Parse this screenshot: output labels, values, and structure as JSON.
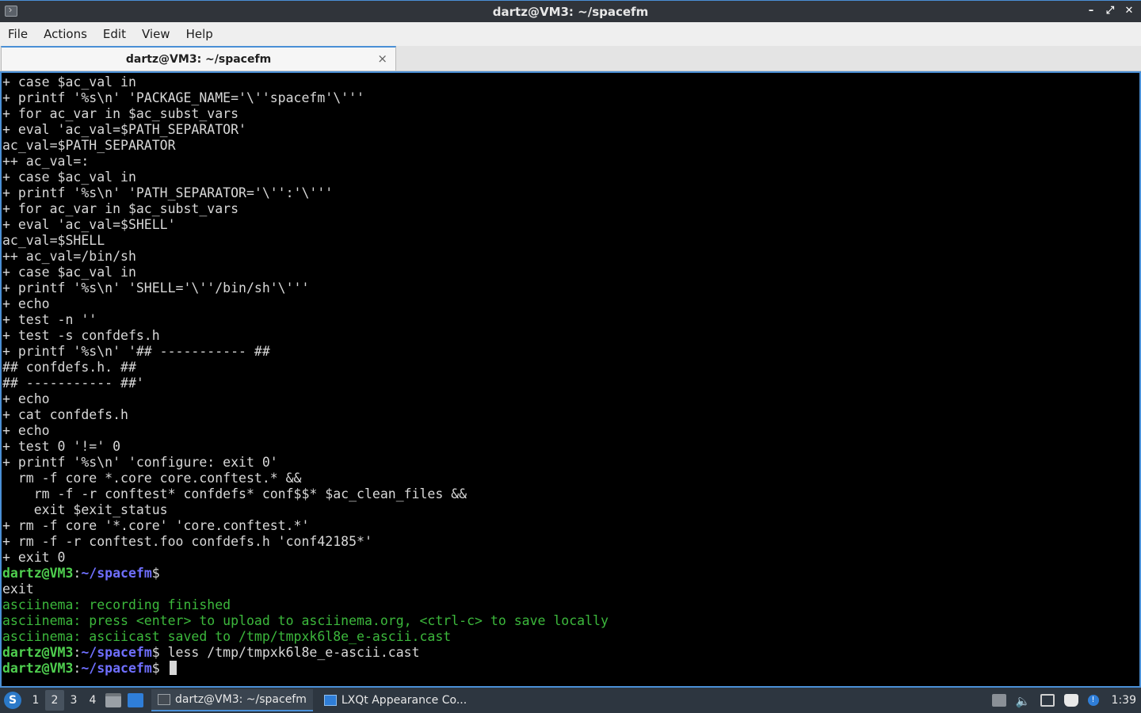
{
  "window": {
    "title": "dartz@VM3: ~/spacefm",
    "controls": {
      "minimize": "–",
      "maximize": "⤢",
      "close": "✕"
    }
  },
  "menu": [
    "File",
    "Actions",
    "Edit",
    "View",
    "Help"
  ],
  "tab": {
    "label": "dartz@VM3: ~/spacefm",
    "close": "×"
  },
  "terminal": {
    "lines": [
      "+ case $ac_val in",
      "+ printf '%s\\n' 'PACKAGE_NAME='\\''spacefm'\\'''",
      "+ for ac_var in $ac_subst_vars",
      "+ eval 'ac_val=$PATH_SEPARATOR'",
      "ac_val=$PATH_SEPARATOR",
      "++ ac_val=:",
      "+ case $ac_val in",
      "+ printf '%s\\n' 'PATH_SEPARATOR='\\'':'\\'''",
      "+ for ac_var in $ac_subst_vars",
      "+ eval 'ac_val=$SHELL'",
      "ac_val=$SHELL",
      "++ ac_val=/bin/sh",
      "+ case $ac_val in",
      "+ printf '%s\\n' 'SHELL='\\''/bin/sh'\\'''",
      "+ echo",
      "+ test -n ''",
      "+ test -s confdefs.h",
      "+ printf '%s\\n' '## ----------- ##",
      "## confdefs.h. ##",
      "## ----------- ##'",
      "+ echo",
      "+ cat confdefs.h",
      "+ echo",
      "+ test 0 '!=' 0",
      "+ printf '%s\\n' 'configure: exit 0'",
      "  rm -f core *.core core.conftest.* &&",
      "    rm -f -r conftest* confdefs* conf$$* $ac_clean_files &&",
      "    exit $exit_status",
      "+ rm -f core '*.core' 'core.conftest.*'",
      "+ rm -f -r conftest.foo confdefs.h 'conf42185*'",
      "+ exit 0"
    ],
    "prompt_user": "dartz@VM3",
    "prompt_sep": ":",
    "prompt_path": "~/spacefm",
    "prompt_symbol": "$",
    "exit_line": "exit",
    "asciinema_lines": [
      "asciinema: recording finished",
      "asciinema: press <enter> to upload to asciinema.org, <ctrl-c> to save locally",
      "asciinema: asciicast saved to /tmp/tmpxk6l8e_e-ascii.cast"
    ],
    "last_command": " less /tmp/tmpxk6l8e_e-ascii.cast",
    "current_input": " "
  },
  "taskbar": {
    "desktops": [
      "1",
      "2",
      "3",
      "4"
    ],
    "active_desktop": "2",
    "tasks": [
      {
        "label": "dartz@VM3: ~/spacefm",
        "active": true
      },
      {
        "label": "LXQt Appearance Co...",
        "active": false
      }
    ],
    "tray": {
      "volume_glyph": "🔈",
      "info_glyph": "!"
    },
    "clock": "1:39"
  }
}
